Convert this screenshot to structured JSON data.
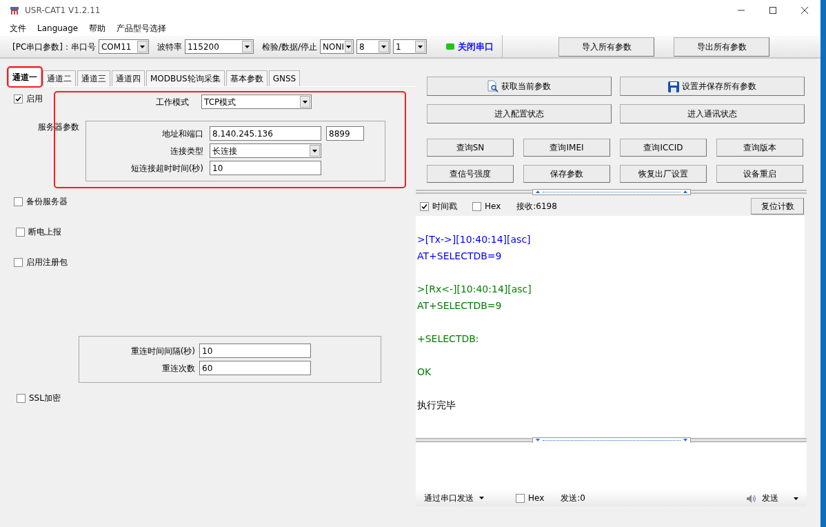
{
  "window": {
    "title": "USR-CAT1 V1.2.11"
  },
  "menu": [
    "文件",
    "Language",
    "帮助",
    "产品型号选择"
  ],
  "serial": {
    "label": "[PC串口参数]：串口号",
    "port": "COM11",
    "baud_label": "波特率",
    "baud": "115200",
    "parity_label": "检验/数据/停止",
    "parity": "NONI",
    "data_bits": "8",
    "stop_bits": "1",
    "open_button": {
      "label": "关闭串口",
      "on": true
    }
  },
  "top_buttons": [
    "导入所有参数",
    "导出所有参数"
  ],
  "tabs": [
    {
      "label": "通道一",
      "selected": true,
      "highlighted": true
    },
    {
      "label": "通道二",
      "selected": false,
      "highlighted": false
    },
    {
      "label": "通道三",
      "selected": false,
      "highlighted": false
    },
    {
      "label": "通道四",
      "selected": false,
      "highlighted": false
    },
    {
      "label": "MODBUS轮询采集",
      "selected": false,
      "highlighted": false
    },
    {
      "label": "基本参数",
      "selected": false,
      "highlighted": false
    },
    {
      "label": "GNSS",
      "selected": false,
      "highlighted": false
    }
  ],
  "channel": {
    "enabled": {
      "label": "启用",
      "checked": true
    },
    "highlighted": true,
    "work_mode": {
      "label": "工作模式",
      "value": "TCP模式"
    },
    "server_label": "服务器参数",
    "address": {
      "label": "地址和端口",
      "value": "8.140.245.136",
      "port": "8899"
    },
    "connection_type": {
      "label": "连接类型",
      "value": "长连接"
    },
    "timeout": {
      "label": "短连接超时时间(秒)",
      "value": "10"
    }
  },
  "options": [
    {
      "label": "备份服务器",
      "checked": false
    },
    {
      "label": "断电上报",
      "checked": false
    },
    {
      "label": "启用注册包",
      "checked": false
    }
  ],
  "reconnect": {
    "interval": {
      "label": "重连时间间隔(秒)",
      "value": "10"
    },
    "count": {
      "label": "重连次数",
      "value": "60"
    }
  },
  "ssl": {
    "label": "SSL加密",
    "checked": false
  },
  "main_buttons": [
    {
      "label": "获取当前参数",
      "kind": "search"
    },
    {
      "label": "设置并保存所有参数",
      "kind": "save"
    },
    {
      "label": "进入配置状态",
      "kind": "plain"
    },
    {
      "label": "进入通讯状态",
      "kind": "plain"
    }
  ],
  "query_buttons": [
    "查询SN",
    "查询IMEI",
    "查询ICCID",
    "查询版本",
    "查信号强度",
    "保存参数",
    "恢复出厂设置",
    "设备重启"
  ],
  "receive": {
    "timestamp": {
      "label": "时间戳",
      "checked": true
    },
    "hex": {
      "label": "Hex",
      "checked": false
    },
    "count": "接收:6198",
    "reset_button": "复位计数"
  },
  "log": [
    {
      "kind": "tx",
      "lines": [
        ">[Tx->][10:40:14][asc]",
        "AT+SELECTDB=9"
      ]
    },
    {
      "kind": "rx",
      "lines": [
        ">[Rx<-][10:40:14][asc]",
        "AT+SELECTDB=9"
      ]
    },
    {
      "kind": "rx",
      "lines": [
        "+SELECTDB:"
      ]
    },
    {
      "kind": "rx",
      "lines": [
        "OK"
      ]
    },
    {
      "kind": "info",
      "lines": [
        "执行完毕"
      ]
    }
  ],
  "send": {
    "mode": "通过串口发送",
    "hex": {
      "label": "Hex",
      "checked": false
    },
    "count": "发送:0",
    "send_button": "发送"
  }
}
